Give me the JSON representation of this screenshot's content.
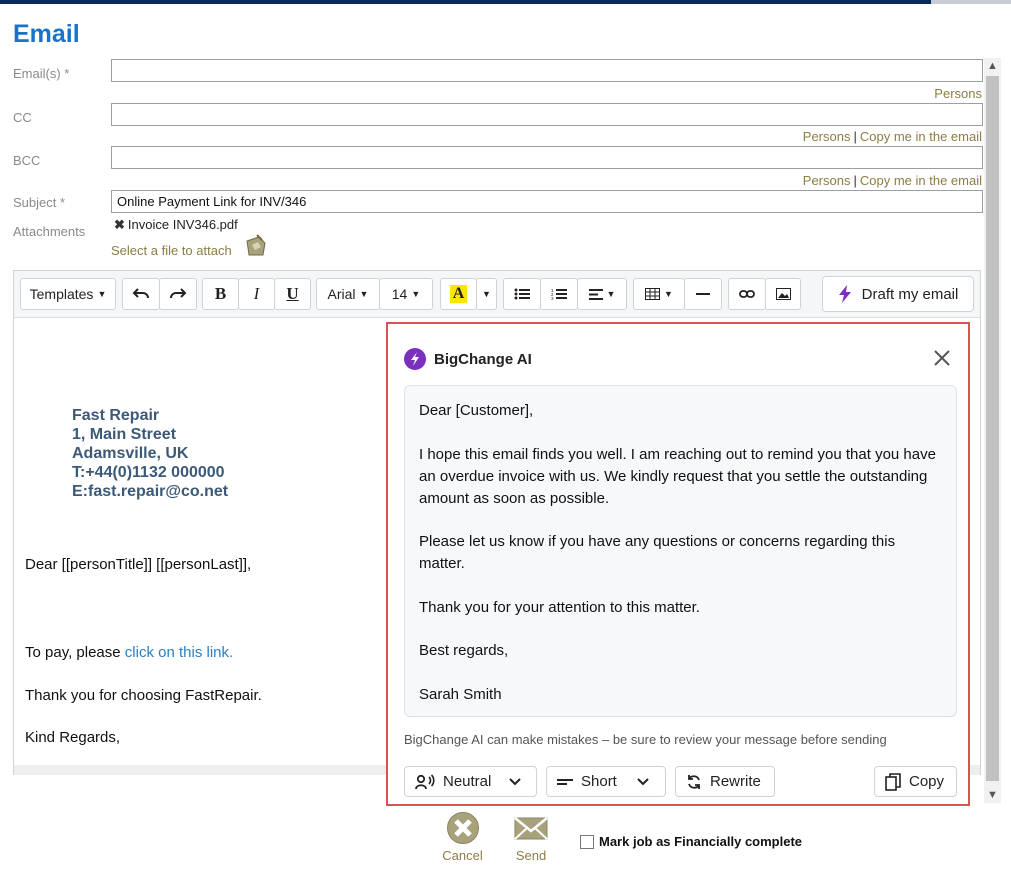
{
  "title": "Email",
  "fields": {
    "emails_label": "Email(s) *",
    "cc_label": "CC",
    "bcc_label": "BCC",
    "subject_label": "Subject *",
    "subject_value": "Online Payment Link for INV/346",
    "attachments_label": "Attachments",
    "attachment_file": "Invoice INV346.pdf",
    "select_file": "Select a file to attach"
  },
  "links": {
    "persons": "Persons",
    "copy_me": "Copy me in the email"
  },
  "toolbar": {
    "templates": "Templates",
    "font": "Arial",
    "size": "14",
    "bold": "B",
    "italic": "I",
    "underline": "U",
    "highlight": "A",
    "draft": "Draft my email"
  },
  "signature": {
    "line1": "Fast Repair",
    "line2": "1, Main Street",
    "line3": "Adamsville, UK",
    "line4": "T:+44(0)1132 000000",
    "line5": "E:fast.repair@co.net"
  },
  "body": {
    "greeting": "Dear [[personTitle]] [[personLast]],",
    "pay_prefix": "To pay, please ",
    "pay_link": "click on this link.",
    "thanks": "Thank you for choosing FastRepair.",
    "regards": "Kind Regards,"
  },
  "ai": {
    "title": "BigChange AI",
    "p1": "Dear [Customer],",
    "p2": "I hope this email finds you well. I am reaching out to remind you that you have an overdue invoice with us. We kindly request that you settle the outstanding amount as soon as possible.",
    "p3": "Please let us know if you have any questions or concerns regarding this matter.",
    "p4": "Thank you for your attention to this matter.",
    "p5": "Best regards,",
    "p6": "Sarah Smith",
    "disclaimer": "BigChange AI can make mistakes – be sure to review your message before sending",
    "tone": "Neutral",
    "length": "Short",
    "rewrite": "Rewrite",
    "copy": "Copy",
    "accent": "#7b2fbf",
    "border": "#d9534f"
  },
  "footer": {
    "cancel": "Cancel",
    "send": "Send",
    "mark": "Mark job as Financially complete"
  }
}
